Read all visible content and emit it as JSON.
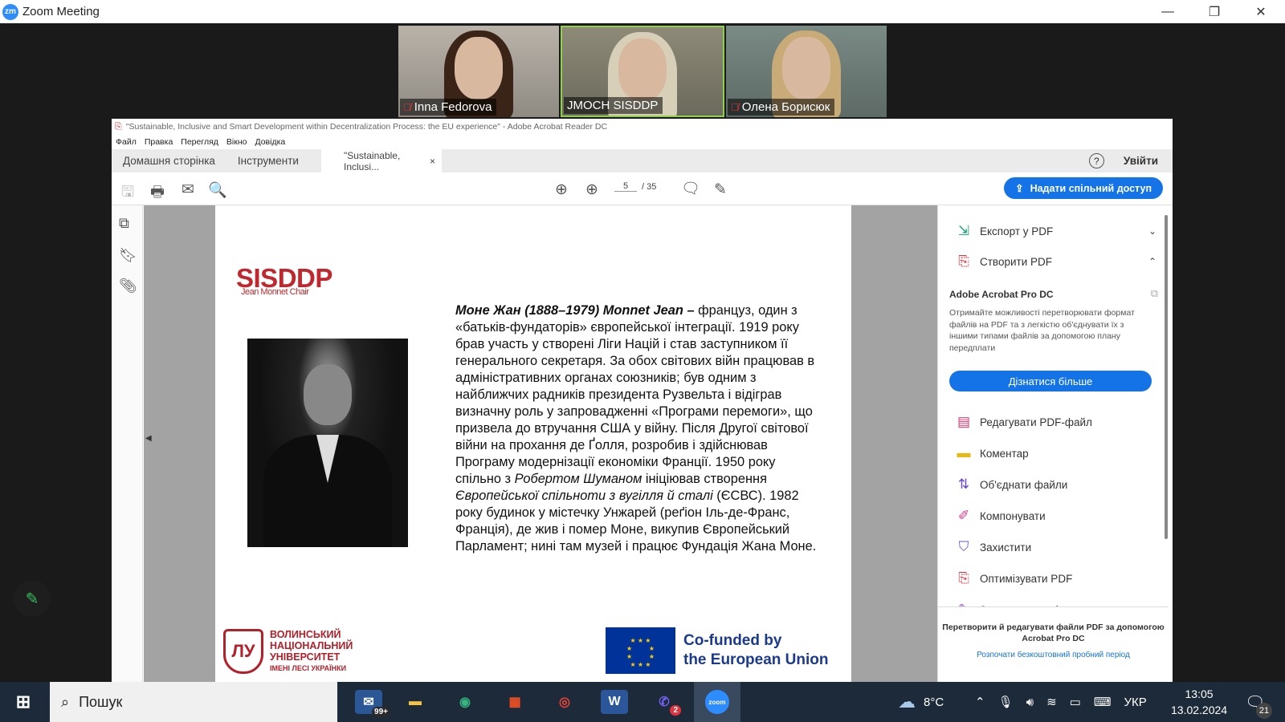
{
  "zoom": {
    "title": "Zoom Meeting",
    "logo": "zm",
    "controls": {
      "minimize": "—",
      "restore": "❐",
      "close": "✕"
    }
  },
  "participants": [
    {
      "name": "Inna Fedorova",
      "muted": true
    },
    {
      "name": "JMOCH SISDDP",
      "muted": false,
      "speaking": true
    },
    {
      "name": "Олена Борисюк",
      "muted": true
    }
  ],
  "acrobat": {
    "title": "\"Sustainable, Inclusive and Smart Development within Decentralization Process: the EU experience\" - Adobe Acrobat Reader DC",
    "menu": [
      "Файл",
      "Правка",
      "Перегляд",
      "Вікно",
      "Довідка"
    ],
    "tabs": {
      "home": "Домашня сторінка",
      "tools": "Інструменти",
      "doc": "\"Sustainable, Inclusi...",
      "close": "×"
    },
    "help": "?",
    "signin": "Увійти",
    "page": {
      "current": "5",
      "total": "/ 35"
    },
    "share": "Надати спільний доступ",
    "right_panel": {
      "export": "Експорт у PDF",
      "create": "Створити PDF",
      "promo_title": "Adobe Acrobat Pro DC",
      "promo_text": "Отримайте можливості перетворювати формат файлів на PDF та з легкістю об'єднувати їх з іншими типами файлів за допомогою плану передплати",
      "learn_more": "Дізнатися більше",
      "tools": [
        {
          "label": "Редагувати PDF-файл",
          "icon": "edit-pdf-icon",
          "color": "#e0336e"
        },
        {
          "label": "Коментар",
          "icon": "comment-icon",
          "color": "#e8b914"
        },
        {
          "label": "Об'єднати файли",
          "icon": "combine-files-icon",
          "color": "#6a47d8"
        },
        {
          "label": "Компонувати",
          "icon": "organize-icon",
          "color": "#d6338a"
        },
        {
          "label": "Захистити",
          "icon": "protect-icon",
          "color": "#6a5acd"
        },
        {
          "label": "Оптимізувати PDF",
          "icon": "optimize-pdf-icon",
          "color": "#e0333e"
        },
        {
          "label": "Заповнити та підписати",
          "icon": "fill-sign-icon",
          "color": "#9b4dd6"
        }
      ],
      "footer_text": "Перетворити й редагувати файли PDF за допомогою Acrobat Pro DC",
      "footer_link": "Розпочати безкоштовний пробний період"
    }
  },
  "document": {
    "logo_title": "SISDDP",
    "logo_sub": "Jean Monnet Chair",
    "bio_heading": "Моне Жан (1888–1979) Monnet Jean –",
    "bio_p1": " француз, один з «батьків-фундаторів» європейської інтеграції. 1919 року брав участь у створені Ліги Націй і став заступником її генерального секретаря. За обох світових війн працював в адміністративних органах союзників; був одним з найближчих радників президента Рузвельта і відіграв визначну роль у запровадженні «Програми перемоги», що призвела до втручання США у війну. Після Другої світової війни на прохання де Ґолля, розробив і здійснював Програму модернізації економіки Франції. 1950 року спільно з ",
    "bio_i1": "Робертом Шуманом",
    "bio_p2": " ініціював створення ",
    "bio_i2": "Європейської спільноти з вугілля й сталі",
    "bio_p3": " (ЄСВС). 1982 року будинок у містечку Унжарей (реґіон Іль-де-Франс, Франція), де жив і помер Моне, викупив Європейський Парламент; нині там музей і працює Фундація Жана Моне.",
    "university": [
      "ВОЛИНСЬКИЙ",
      "НАЦІОНАЛЬНИЙ",
      "УНІВЕРСИТЕТ",
      "ІМЕНІ ЛЕСІ УКРАЇНКИ"
    ],
    "eu_line1": "Co-funded by",
    "eu_line2": "the European Union"
  },
  "taskbar": {
    "search": "Пошук",
    "mail_badge": "99+",
    "viber_badge": "2",
    "weather": "8°C",
    "lang": "УКР",
    "time": "13:05",
    "date": "13.02.2024",
    "notifications": "21"
  }
}
